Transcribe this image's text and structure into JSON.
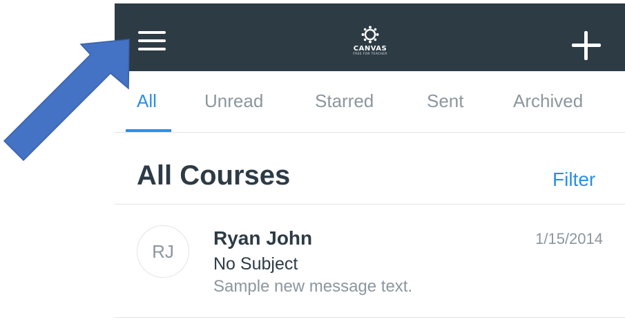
{
  "topbar": {
    "menu_icon": "hamburger-menu-icon",
    "logo_name": "CANVAS",
    "logo_tagline": "FREE FOR TEACHER",
    "compose_icon": "plus-icon"
  },
  "tabs": [
    {
      "label": "All",
      "active": true
    },
    {
      "label": "Unread",
      "active": false
    },
    {
      "label": "Starred",
      "active": false
    },
    {
      "label": "Sent",
      "active": false
    },
    {
      "label": "Archived",
      "active": false
    }
  ],
  "header": {
    "title": "All Courses",
    "filter_label": "Filter"
  },
  "messages": [
    {
      "initials": "RJ",
      "sender": "Ryan John",
      "subject": "No Subject",
      "preview": "Sample new message text.",
      "date": "1/15/2014"
    }
  ],
  "annotation": {
    "arrow_icon": "pointer-arrow-icon",
    "arrow_color": "#4472c4"
  },
  "colors": {
    "topbar": "#2d3b45",
    "accent": "#2b8ee8",
    "muted_text": "#8b969e",
    "primary_text": "#2d3b45"
  }
}
